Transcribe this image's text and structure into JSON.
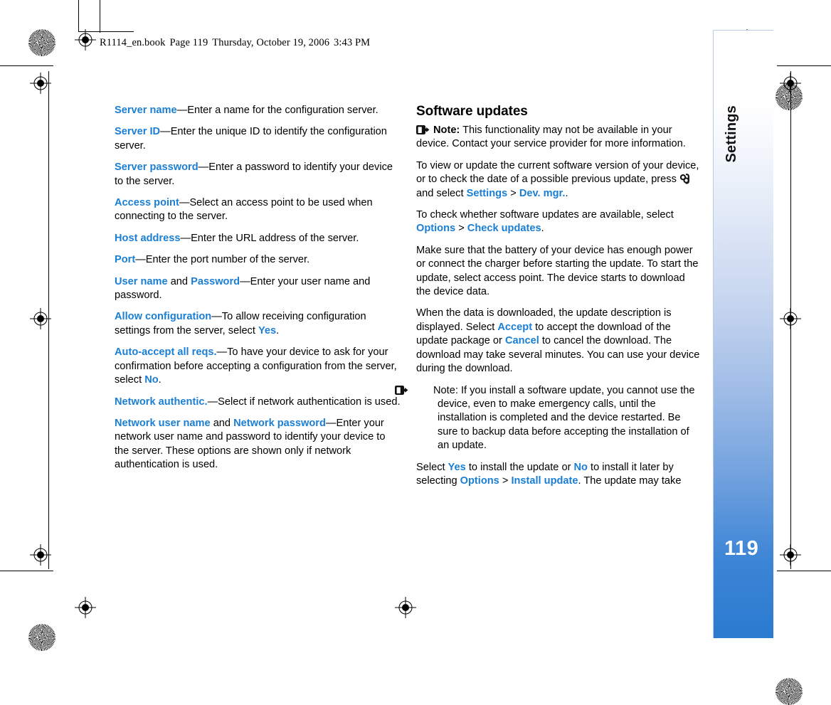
{
  "header": {
    "filename": "R1114_en.book",
    "page_label": "Page 119",
    "date": "Thursday, October 19, 2006",
    "time": "3:43 PM"
  },
  "sidebar": {
    "chapter_label": "Settings",
    "page_number": "119",
    "accent_color": "#2a7ad0"
  },
  "colors": {
    "keyword_blue": "#1a7fd4",
    "body_black": "#000000"
  },
  "left_column": {
    "paragraphs": [
      {
        "id": "server-name",
        "parts": [
          {
            "t": "Server name",
            "s": "kw"
          },
          {
            "t": "—Enter a name for the configuration server.",
            "s": "n"
          }
        ]
      },
      {
        "id": "server-id",
        "parts": [
          {
            "t": "Server ID",
            "s": "kw"
          },
          {
            "t": "—Enter the unique ID to identify the configuration server.",
            "s": "n"
          }
        ]
      },
      {
        "id": "server-password",
        "parts": [
          {
            "t": "Server password",
            "s": "kw"
          },
          {
            "t": "—Enter a password to identify your device to the server.",
            "s": "n"
          }
        ]
      },
      {
        "id": "access-point",
        "parts": [
          {
            "t": "Access point",
            "s": "kw"
          },
          {
            "t": "—Select an access point to be used when connecting to the server.",
            "s": "n"
          }
        ]
      },
      {
        "id": "host-address",
        "parts": [
          {
            "t": "Host address",
            "s": "kw"
          },
          {
            "t": "—Enter the URL address of the server.",
            "s": "n"
          }
        ]
      },
      {
        "id": "port",
        "parts": [
          {
            "t": "Port",
            "s": "kw"
          },
          {
            "t": "—Enter the port number of the server.",
            "s": "n"
          }
        ]
      },
      {
        "id": "user-name-password",
        "parts": [
          {
            "t": "User name",
            "s": "kw"
          },
          {
            "t": " and ",
            "s": "n"
          },
          {
            "t": "Password",
            "s": "kw"
          },
          {
            "t": "—Enter your user name and password.",
            "s": "n"
          }
        ]
      },
      {
        "id": "allow-configuration",
        "parts": [
          {
            "t": "Allow configuration",
            "s": "kw"
          },
          {
            "t": "—To allow receiving configuration settings from the server, select ",
            "s": "n"
          },
          {
            "t": "Yes",
            "s": "kw"
          },
          {
            "t": ".",
            "s": "n"
          }
        ]
      },
      {
        "id": "auto-accept-all-reqs",
        "parts": [
          {
            "t": "Auto-accept all reqs.",
            "s": "kw"
          },
          {
            "t": "—To have your device to ask for your confirmation before accepting a configuration from the server, select ",
            "s": "n"
          },
          {
            "t": "No",
            "s": "kw"
          },
          {
            "t": ".",
            "s": "n"
          }
        ]
      },
      {
        "id": "network-authentic",
        "parts": [
          {
            "t": "Network authentic.",
            "s": "kw"
          },
          {
            "t": "—Select if network authentication is used.",
            "s": "n"
          }
        ]
      },
      {
        "id": "network-user-name-password",
        "parts": [
          {
            "t": "Network user name",
            "s": "kw"
          },
          {
            "t": " and ",
            "s": "n"
          },
          {
            "t": "Network password",
            "s": "kw"
          },
          {
            "t": "—Enter your network user name and password to identify your device to the server. These options are shown only if network authentication is used.",
            "s": "n"
          }
        ]
      }
    ]
  },
  "right_column": {
    "heading": "Software updates",
    "note_1": {
      "icon": "note-icon",
      "label": "Note:",
      "text": " This functionality may not be available in your device. Contact your service provider for more information."
    },
    "paragraphs": [
      {
        "id": "view-or-update",
        "parts": [
          {
            "t": "To view or update the current software version of your device, or to check the date of a possible previous update, press ",
            "s": "n"
          },
          {
            "t": "menu-key-icon",
            "s": "icon"
          },
          {
            "t": " and select ",
            "s": "n"
          },
          {
            "t": "Settings",
            "s": "kw"
          },
          {
            "t": " > ",
            "s": "n"
          },
          {
            "t": "Dev. mgr.",
            "s": "kw"
          },
          {
            "t": ".",
            "s": "n"
          }
        ]
      },
      {
        "id": "check-updates",
        "parts": [
          {
            "t": "To check whether software updates are available, select ",
            "s": "n"
          },
          {
            "t": "Options",
            "s": "kw"
          },
          {
            "t": " > ",
            "s": "n"
          },
          {
            "t": "Check updates",
            "s": "kw"
          },
          {
            "t": ".",
            "s": "n"
          }
        ]
      },
      {
        "id": "battery-power",
        "parts": [
          {
            "t": "Make sure that the battery of your device has enough power or connect the charger before starting the update. To start the update, select access point. The device starts to download the device data.",
            "s": "n"
          }
        ]
      },
      {
        "id": "update-description",
        "parts": [
          {
            "t": "When the data is downloaded, the update description is displayed. Select ",
            "s": "n"
          },
          {
            "t": "Accept",
            "s": "kw"
          },
          {
            "t": " to accept the download of the update package or ",
            "s": "n"
          },
          {
            "t": "Cancel",
            "s": "kw"
          },
          {
            "t": " to cancel the download. The download may take several minutes. You can use your device during the download.",
            "s": "n"
          }
        ]
      }
    ],
    "note_2": {
      "icon": "note-icon",
      "label": "Note:",
      "text": " If you install a software update, you cannot use the device, even to make emergency calls, until the installation is completed and the device restarted. Be sure to backup data before accepting the installation of an update."
    },
    "closing_paragraph": {
      "id": "install-update",
      "parts": [
        {
          "t": "Select ",
          "s": "n"
        },
        {
          "t": "Yes",
          "s": "kw"
        },
        {
          "t": " to install the update or ",
          "s": "n"
        },
        {
          "t": "No",
          "s": "kw"
        },
        {
          "t": " to install it later by selecting ",
          "s": "n"
        },
        {
          "t": "Options",
          "s": "kw"
        },
        {
          "t": " > ",
          "s": "n"
        },
        {
          "t": "Install update",
          "s": "kw"
        },
        {
          "t": ". The update may take",
          "s": "n"
        }
      ]
    }
  }
}
